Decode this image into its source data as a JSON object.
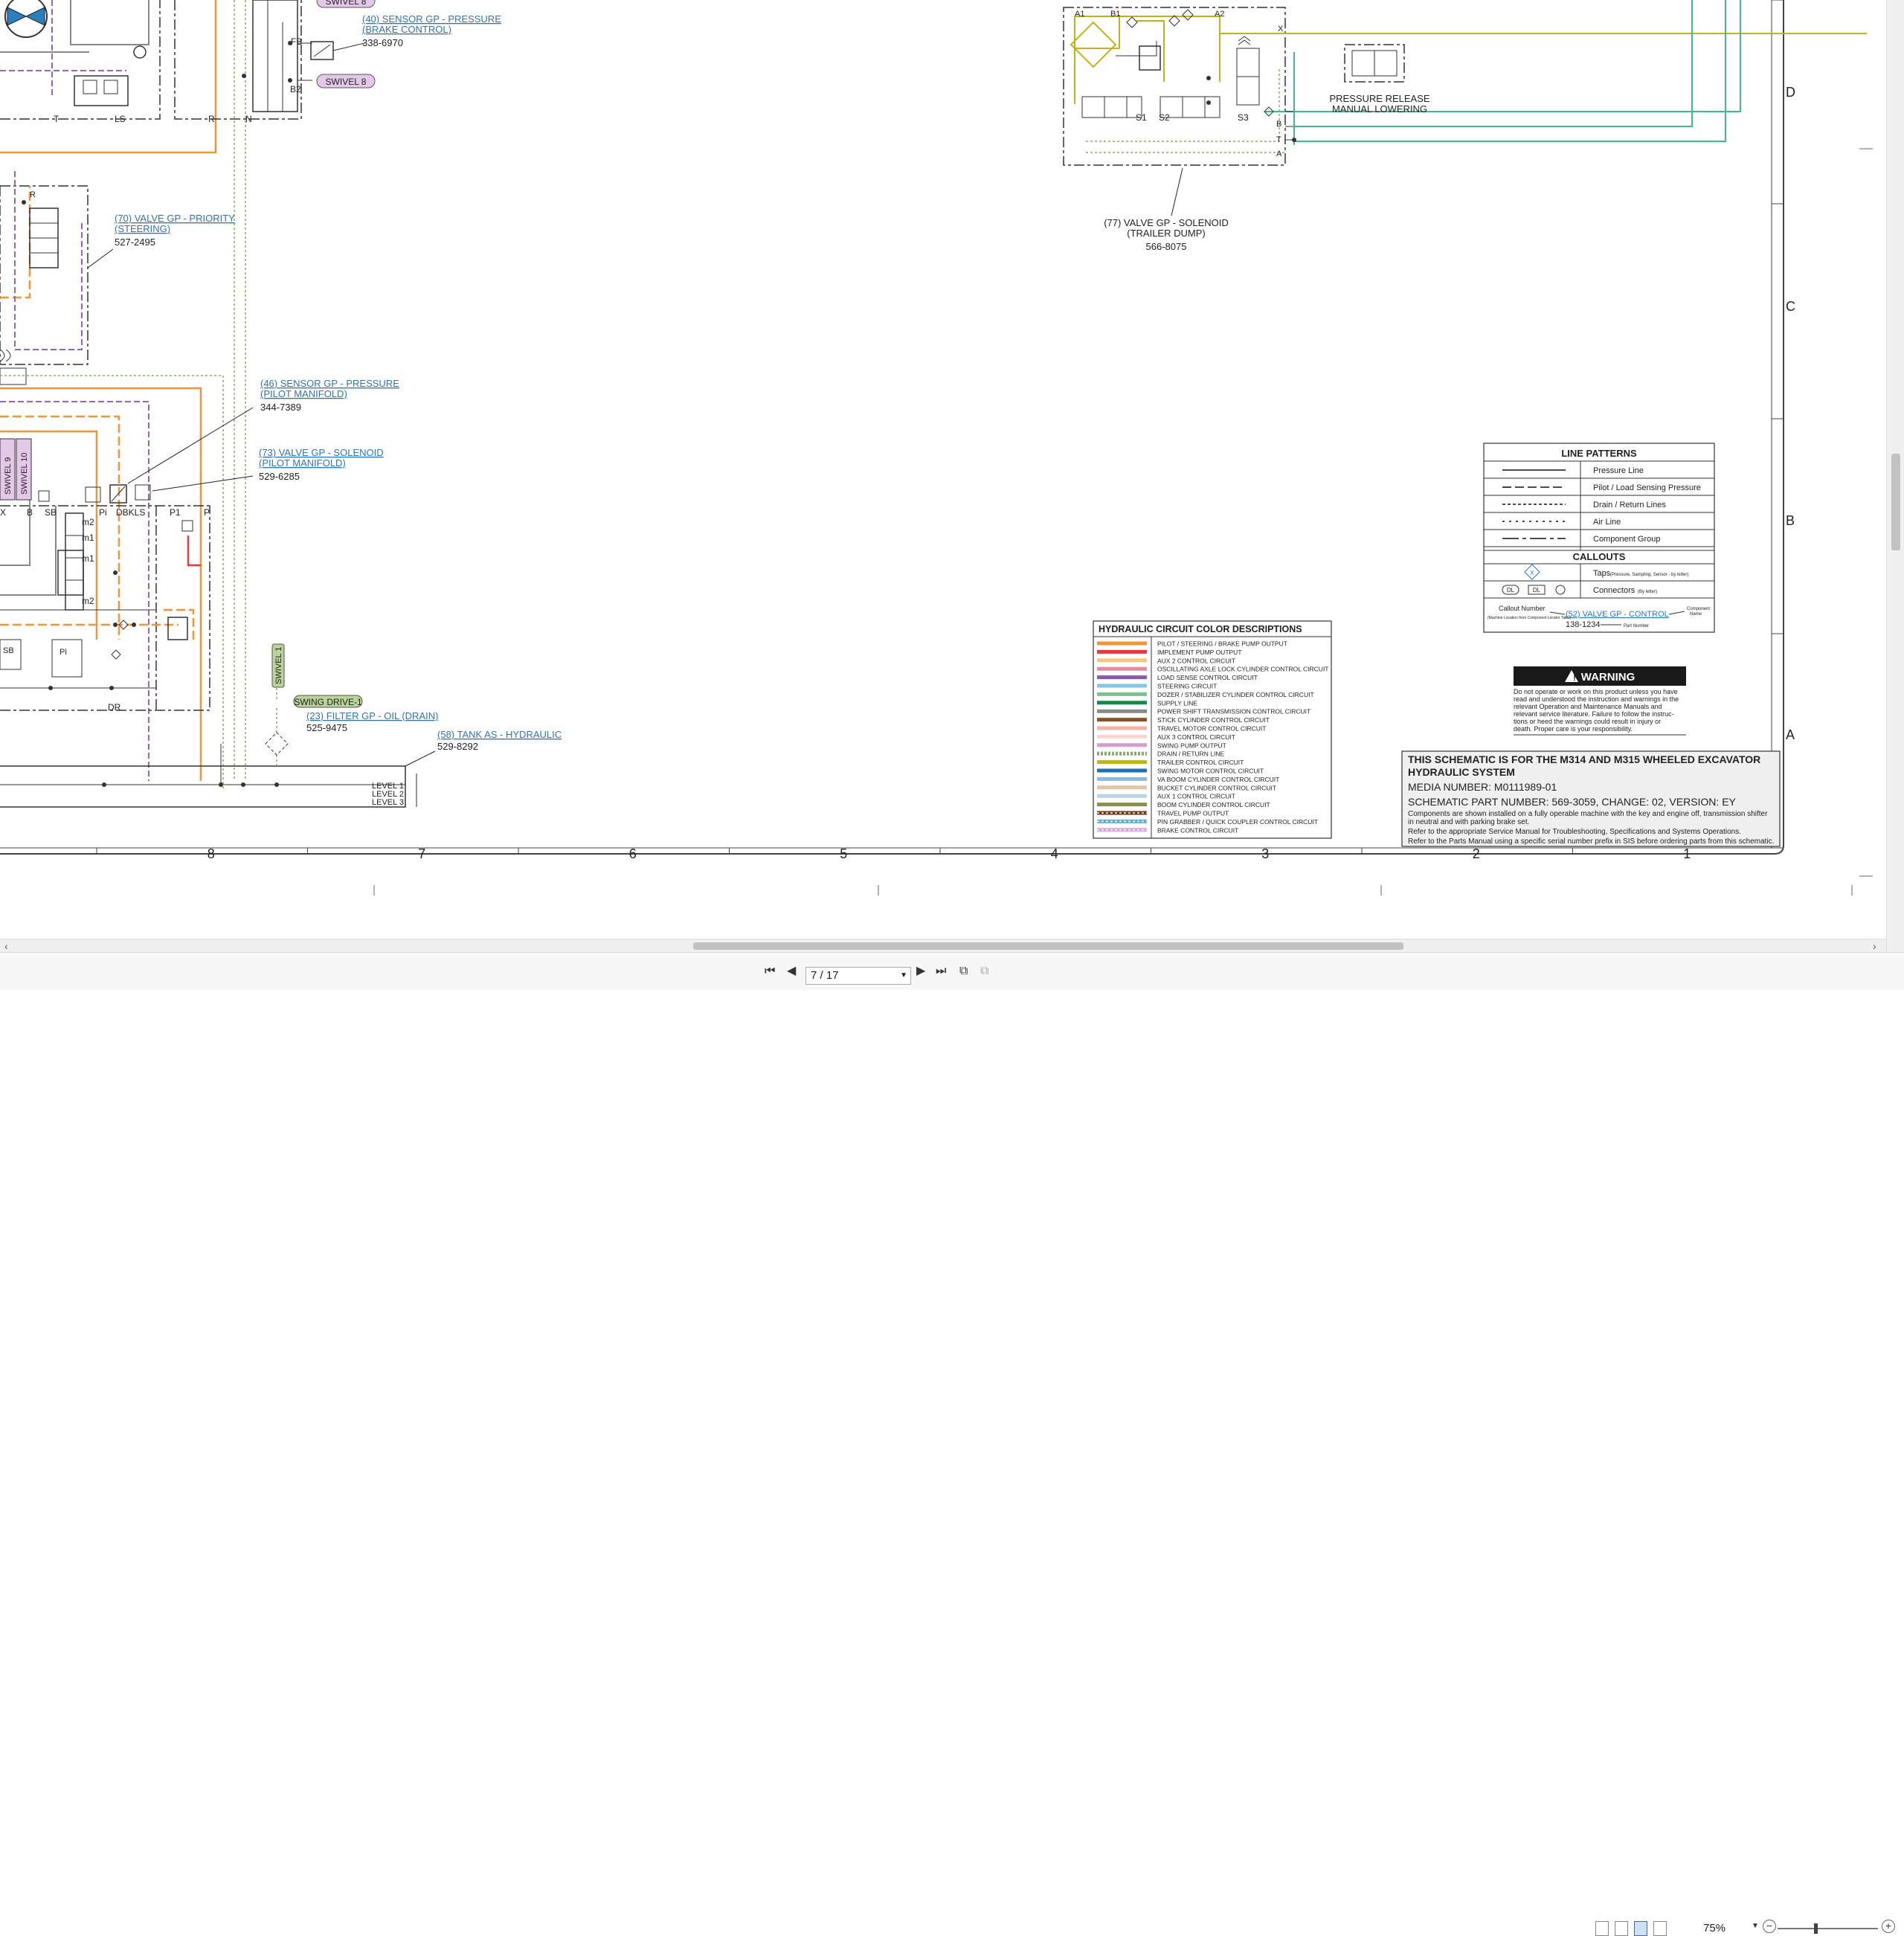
{
  "document": {
    "callouts": [
      {
        "title": "(40) SENSOR GP - PRESSURE",
        "sub": "(BRAKE CONTROL)",
        "part": "338-6970"
      },
      {
        "title": "(70) VALVE GP - PRIORITY",
        "sub": "(STEERING)",
        "part": "527-2495"
      },
      {
        "title": "(46) SENSOR GP - PRESSURE",
        "sub": "(PILOT MANIFOLD)",
        "part": "344-7389"
      },
      {
        "title": "(73) VALVE GP - SOLENOID",
        "sub": "(PILOT MANIFOLD)",
        "part": "529-6285"
      },
      {
        "title": "(23) FILTER GP - OIL (DRAIN)",
        "part": "525-9475"
      },
      {
        "title": "(58) TANK AS - HYDRAULIC",
        "part": "529-8292"
      }
    ],
    "solenoid_callout": {
      "line1": "(77) VALVE GP - SOLENOID",
      "line2": "(TRAILER DUMP)",
      "part": "566-8075"
    },
    "pressure_release": {
      "line1": "PRESSURE RELEASE",
      "line2": "MANUAL LOWERING"
    },
    "swivel_tags": [
      "SWIVEL 8",
      "SWIVEL 8",
      "SWIVEL 9",
      "SWIVEL 10",
      "SWIVEL 1"
    ],
    "swing_tag": "SWING DRIVE-1",
    "tank_levels": [
      "LEVEL 1",
      "LEVEL 2",
      "LEVEL 3"
    ],
    "port_labels": {
      "top": [
        "T",
        "LS",
        "R",
        "N",
        "FB",
        "B2"
      ],
      "solenoid_top": [
        "A1",
        "B1",
        "A2",
        "X"
      ],
      "solenoid_bottom": [
        "S1",
        "S2",
        "S3",
        "B",
        "T",
        "A"
      ],
      "manifold": [
        "X",
        "B",
        "SB",
        "Pi",
        "DBKLS",
        "P1",
        "P",
        "DR",
        "SB",
        "Pi",
        "m2",
        "m1",
        "m1",
        "m2",
        "R"
      ]
    },
    "line_patterns": {
      "title": "LINE PATTERNS",
      "rows": [
        "Pressure Line",
        "Pilot / Load Sensing Pressure",
        "Drain / Return Lines",
        "Air Line",
        "Component Group"
      ],
      "callouts_title": "CALLOUTS",
      "taps_label": "Taps",
      "taps_note": "(Pressure, Sampling, Sensor - by letter)",
      "connectors_label": "Connectors",
      "connectors_note": "(By letter)",
      "connector_marks": [
        "DL",
        "DL"
      ],
      "tap_mark": "X",
      "example_callout_label": "Callout Number",
      "example_callout_note": "(Machine Location from Component Locator Table)",
      "example_link": "(52) VALVE GP - CONTROL",
      "example_part": "138-1234",
      "example_part_note": "Part Number",
      "example_component_label": "Component",
      "example_component_label2": "Name"
    },
    "warning": {
      "title": "WARNING",
      "lines": [
        "Do not operate or work on this product unless you have",
        "read and understood the instruction and warnings in the",
        "relevant Operation and Maintenance Manuals and",
        "relevant service literature. Failure to follow the instruc-",
        "tions or heed the warnings could result in injury or",
        "death. Proper care is your responsibility."
      ]
    },
    "color_legend": {
      "title": "HYDRAULIC CIRCUIT COLOR DESCRIPTIONS",
      "rows": [
        {
          "label": "PILOT / STEERING / BRAKE PUMP OUTPUT",
          "color": "#f0953a"
        },
        {
          "label": "IMPLEMENT PUMP OUTPUT",
          "color": "#e23b3b"
        },
        {
          "label": "AUX 2 CONTROL CIRCUIT",
          "color": "#f5c77e"
        },
        {
          "label": "OSCILLATING AXLE LOCK CYLINDER CONTROL CIRCUIT",
          "color": "#e8899e"
        },
        {
          "label": "LOAD SENSE CONTROL CIRCUIT",
          "color": "#8b59a8"
        },
        {
          "label": "STEERING CIRCUIT",
          "color": "#86c6e4"
        },
        {
          "label": "DOZER / STABILIZER CYLINDER CONTROL CIRCUIT",
          "color": "#7fbf8f"
        },
        {
          "label": "SUPPLY LINE",
          "color": "#128a4e"
        },
        {
          "label": "POWER SHIFT TRANSMISSION CONTROL CIRCUIT",
          "color": "#8a8a8a"
        },
        {
          "label": "STICK CYLINDER CONTROL CIRCUIT",
          "color": "#8a5228"
        },
        {
          "label": "TRAVEL MOTOR CONTROL CIRCUIT",
          "color": "#f2b5a3"
        },
        {
          "label": "AUX 3 CONTROL CIRCUIT",
          "color": "#f8d7d2"
        },
        {
          "label": "SWING PUMP OUTPUT",
          "color": "#d89ccc"
        },
        {
          "label": "DRAIN / RETURN LINE",
          "color": "#8aa86a"
        },
        {
          "label": "TRAILER CONTROL CIRCUIT",
          "color": "#c2b21d"
        },
        {
          "label": "SWING MOTOR CONTROL CIRCUIT",
          "color": "#1e6fb5"
        },
        {
          "label": "VA BOOM CYLINDER CONTROL CIRCUIT",
          "color": "#8fb9dd"
        },
        {
          "label": "BUCKET CYLINDER CONTROL CIRCUIT",
          "color": "#e1c5a6"
        },
        {
          "label": "AUX 1 CONTROL CIRCUIT",
          "color": "#bcd3e3"
        },
        {
          "label": "BOOM CYLINDER CONTROL CIRCUIT",
          "color": "#8b8f4d"
        },
        {
          "label": "TRAVEL PUMP OUTPUT",
          "color": "#6b3a1a"
        },
        {
          "label": "PIN GRABBER / QUICK COUPLER CONTROL CIRCUIT",
          "color": "#5ab0d6"
        },
        {
          "label": "BRAKE CONTROL CIRCUIT",
          "color": "#d8a6d8"
        }
      ]
    },
    "title_block": {
      "line1": "THIS SCHEMATIC IS FOR THE M314 AND M315 WHEELED EXCAVATOR",
      "line2": "HYDRAULIC SYSTEM",
      "media": "MEDIA NUMBER: M0111989-01",
      "part": "SCHEMATIC PART NUMBER: 569-3059, CHANGE: 02, VERSION: EY",
      "notes": [
        "Components are shown installed on a fully operable machine with the key and engine off, transmission shifter",
        "in neutral and with parking brake set.",
        "Refer to the appropriate Service Manual for Troubleshooting, Specifications and Systems Operations.",
        "Refer to the Parts Manual using a specific serial number prefix in SIS before ordering parts from this schematic."
      ]
    },
    "grid_columns": [
      "8",
      "7",
      "6",
      "5",
      "4",
      "3",
      "2",
      "1"
    ],
    "grid_rows": [
      "D",
      "C",
      "B",
      "A"
    ]
  },
  "toolbar": {
    "page_value": "7 / 17",
    "zoom": "75%",
    "zoom_level": 0.38,
    "icons": [
      "first-page-icon",
      "prev-page-icon",
      "next-page-icon",
      "last-page-icon",
      "copy-icon",
      "copy-disabled-icon"
    ],
    "view_modes": [
      "single-page-icon",
      "continuous-icon",
      "two-page-icon",
      "thumbnail-icon"
    ]
  },
  "colors": {
    "pilot": "#f0953a",
    "loadsense": "#9c62b3",
    "drain": "#8aa86a",
    "trailer": "#c2b21d",
    "supply": "#3fb892",
    "link": "#2d74b5",
    "swivel_fill": "#e3c8e8",
    "swivel_green": "#b9d39a"
  }
}
